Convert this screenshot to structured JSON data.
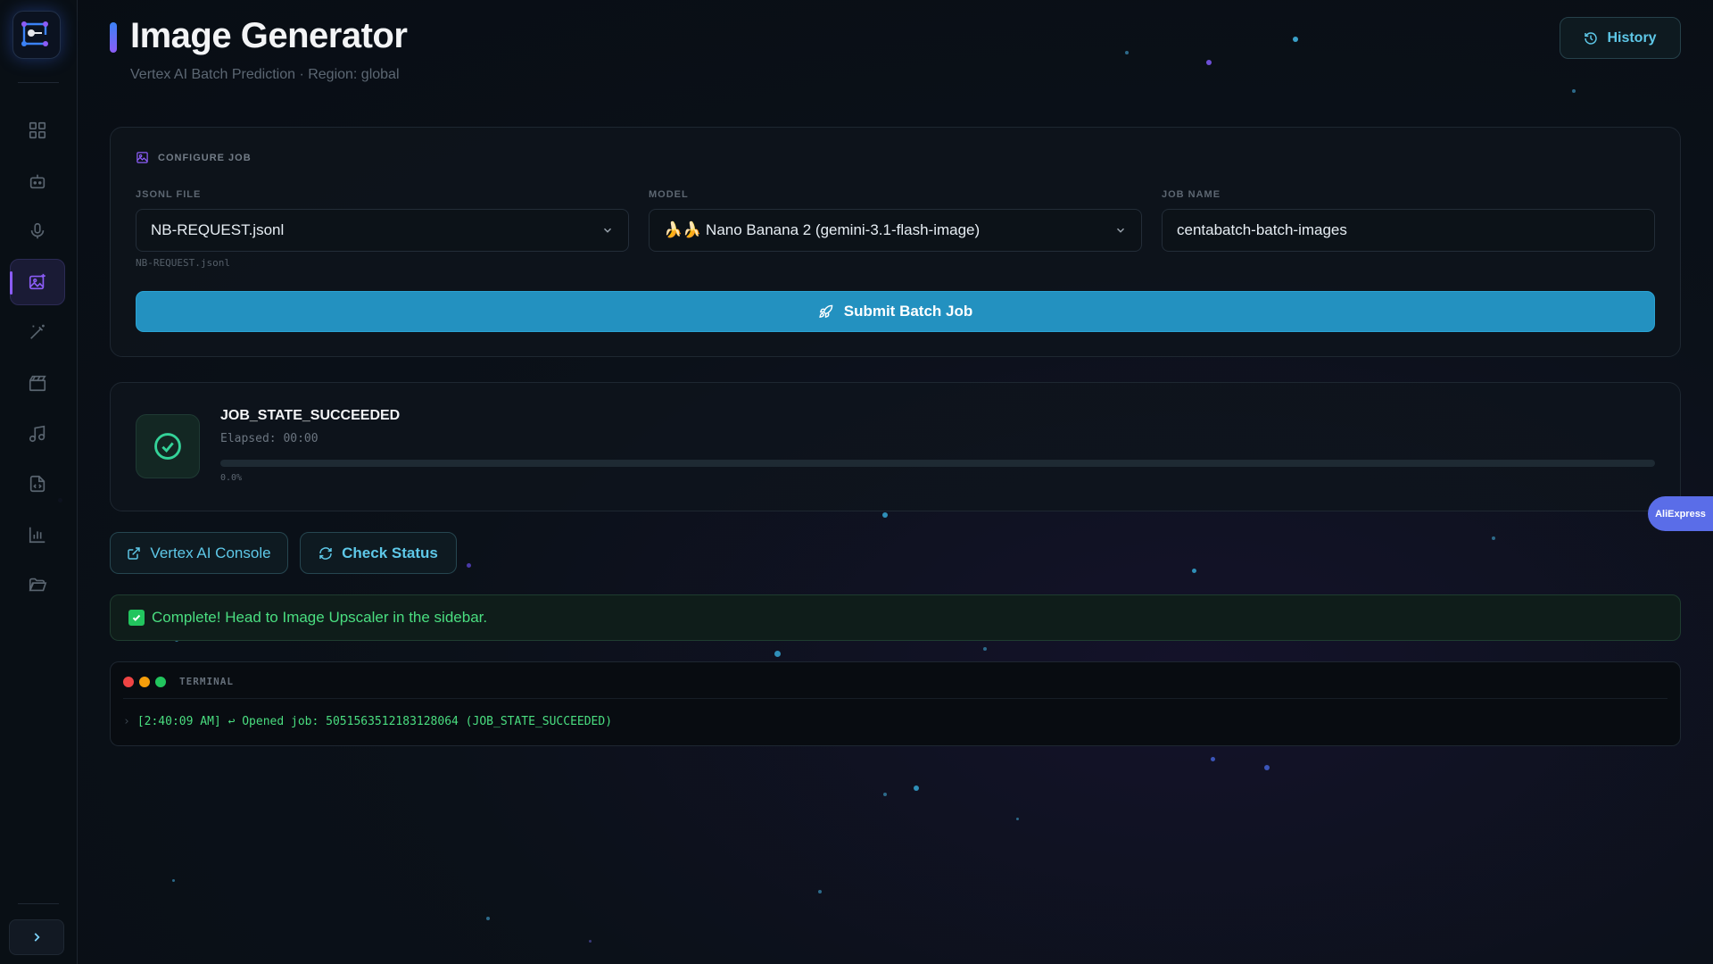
{
  "header": {
    "title": "Image Generator",
    "subtitle": "Vertex AI Batch Prediction · Region: global",
    "history_label": "History"
  },
  "sidebar": {
    "items": [
      {
        "icon": "dashboard-icon"
      },
      {
        "icon": "robot-icon"
      },
      {
        "icon": "microphone-icon"
      },
      {
        "icon": "image-generate-icon",
        "active": true
      },
      {
        "icon": "magic-wand-icon"
      },
      {
        "icon": "clapperboard-icon"
      },
      {
        "icon": "music-note-icon"
      },
      {
        "icon": "code-file-icon"
      },
      {
        "icon": "bar-chart-icon"
      },
      {
        "icon": "folder-open-icon"
      }
    ],
    "expand_icon": "chevron-right-icon"
  },
  "config": {
    "section_label": "CONFIGURE JOB",
    "jsonl_label": "JSONL FILE",
    "jsonl_value": "NB-REQUEST.jsonl",
    "jsonl_hint": "NB-REQUEST.jsonl",
    "model_label": "MODEL",
    "model_value": "🍌🍌 Nano Banana 2 (gemini-3.1-flash-image)",
    "jobname_label": "JOB NAME",
    "jobname_value": "centabatch-batch-images",
    "submit_label": "Submit Batch Job"
  },
  "status": {
    "state": "JOB_STATE_SUCCEEDED",
    "elapsed": "Elapsed: 00:00",
    "progress_percent": 0.0,
    "progress_text": "0.0%"
  },
  "actions": {
    "console_label": "Vertex AI Console",
    "check_label": "Check Status"
  },
  "ali_badge": "AliExpress",
  "banner": {
    "text": "Complete! Head to Image Upscaler in the sidebar."
  },
  "terminal": {
    "label": "TERMINAL",
    "line": "[2:40:09 AM] ↩ Opened job: 5051563512183128064 (JOB_STATE_SUCCEEDED)"
  },
  "colors": {
    "accent": "#2391c0",
    "accent_text": "#5ec8e8",
    "success": "#4ade80",
    "sidebar_active": "#8b5cf6"
  }
}
